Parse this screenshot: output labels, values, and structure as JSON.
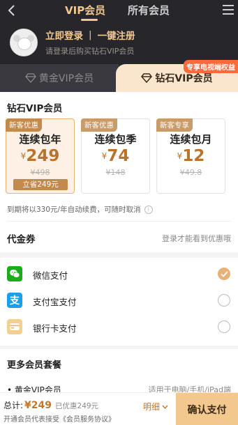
{
  "nav": {
    "tabs": [
      "VIP会员",
      "所有会员"
    ]
  },
  "user": {
    "login": "立即登录",
    "register": "一键注册",
    "subtitle": "请登录后购买钻石VIP会员"
  },
  "vip_tabs": {
    "gold": "黄金VIP会员",
    "diamond": "钻石VIP会员",
    "tv_badge": "专享电视端权益"
  },
  "main": {
    "section_title": "钻石VIP会员",
    "plans": [
      {
        "tag": "新客优惠",
        "name": "连续包年",
        "currency": "¥",
        "price": "249",
        "original": "¥498",
        "save": "立省249元",
        "selected": true
      },
      {
        "tag": "新客优惠",
        "name": "连续包季",
        "currency": "¥",
        "price": "74",
        "original": "¥148",
        "selected": false
      },
      {
        "tag": "新客专享",
        "name": "连续包月",
        "currency": "¥",
        "price": "12",
        "original": "¥49.8",
        "selected": false
      }
    ],
    "renew_note": "到期将以330元/年自动续费，可随时取消",
    "coupon_label": "代金券",
    "coupon_hint": "登录才能看到优惠哦",
    "payments": [
      {
        "label": "微信支付",
        "icon": "wechat-pay-icon",
        "checked": true
      },
      {
        "label": "支付宝支付",
        "icon": "alipay-icon",
        "checked": false
      },
      {
        "label": "银行卡支付",
        "icon": "bank-card-icon",
        "checked": false
      }
    ]
  },
  "more": {
    "title": "更多会员套餐",
    "item": "• 黄金VIP会员",
    "item_note": "适用于电脑/手机/iPad端"
  },
  "bottom": {
    "total_label": "总计:",
    "total_amount": "¥249",
    "discount": "已优惠249元",
    "agreement": "开通会员代表接受《会员服务协议》",
    "detail": "明细",
    "pay_button": "确认支付"
  },
  "colors": {
    "header_bg": "#27262b",
    "gold_accent": "#f2c88e",
    "price_color": "#b8732f"
  }
}
